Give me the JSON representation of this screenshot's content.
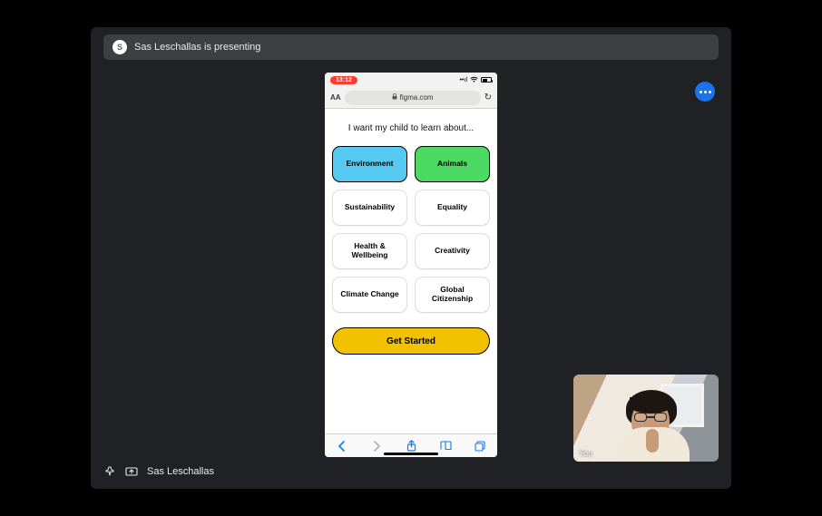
{
  "banner": {
    "text": "Sas Leschallas is presenting",
    "avatar_initial": "S"
  },
  "bottom_presenter_name": "Sas Leschallas",
  "self_video": {
    "label": "You"
  },
  "phone": {
    "status": {
      "time": "13:12"
    },
    "url_bar": {
      "aa": "AA",
      "domain": "figma.com"
    },
    "page": {
      "heading": "I want my child to learn about...",
      "tiles": [
        {
          "label": "Environment",
          "variant": "blue"
        },
        {
          "label": "Animals",
          "variant": "green"
        },
        {
          "label": "Sustainability",
          "variant": "plain"
        },
        {
          "label": "Equality",
          "variant": "plain"
        },
        {
          "label": "Health & Wellbeing",
          "variant": "plain"
        },
        {
          "label": "Creativity",
          "variant": "plain"
        },
        {
          "label": "Climate Change",
          "variant": "plain"
        },
        {
          "label": "Global Citizenship",
          "variant": "plain"
        }
      ],
      "cta_label": "Get Started"
    }
  }
}
